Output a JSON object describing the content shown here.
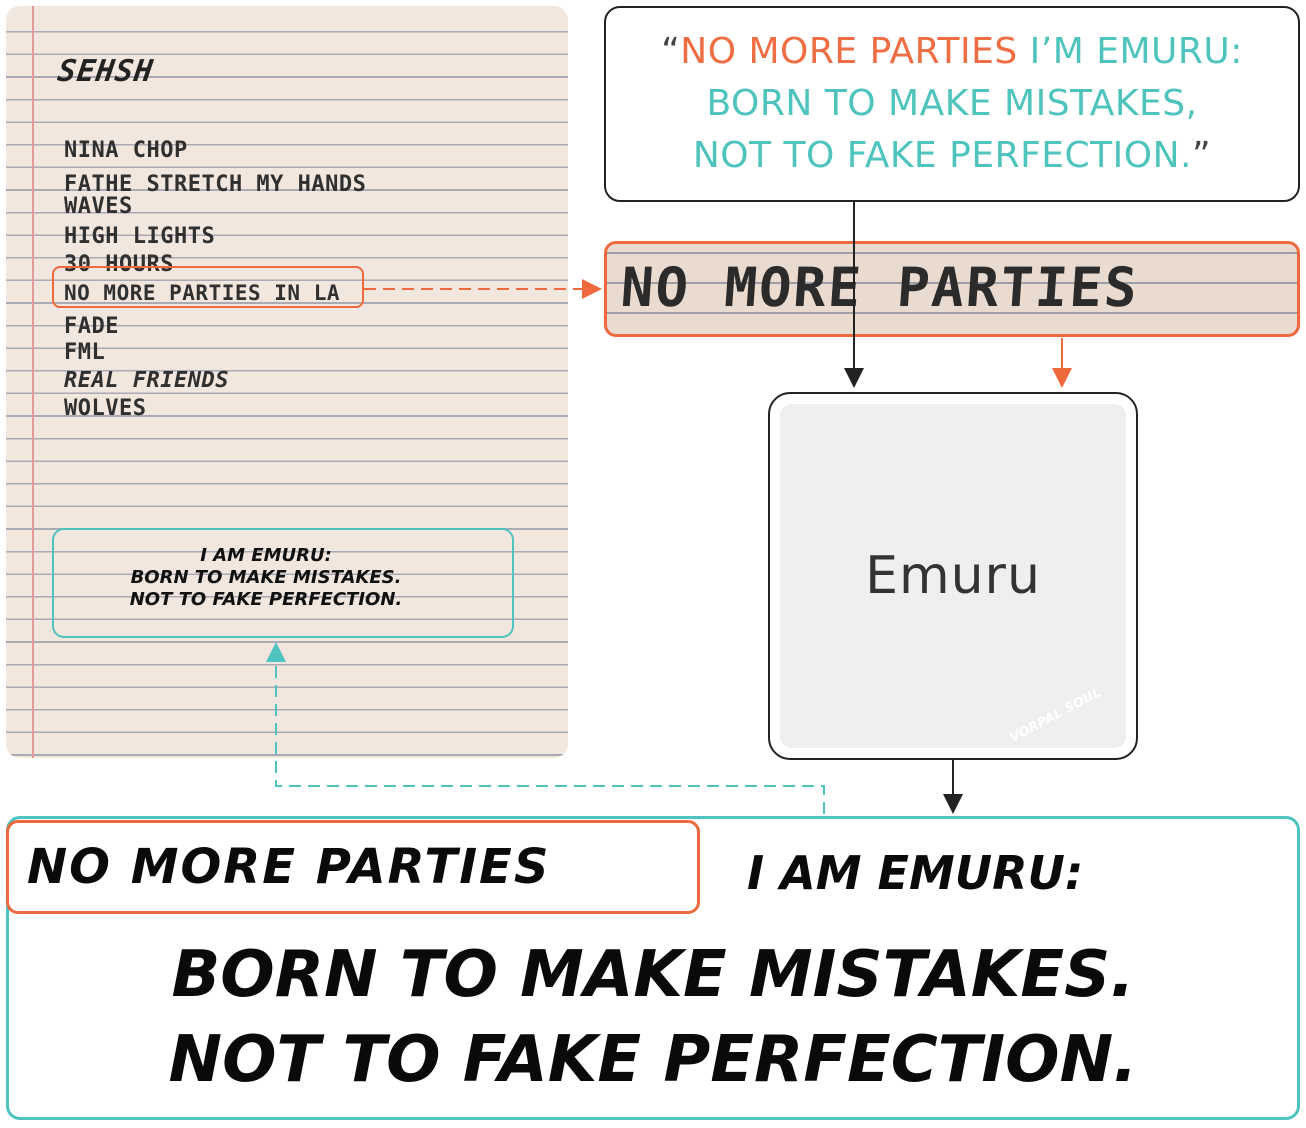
{
  "notebook": {
    "title": "SEHSH",
    "tracks": [
      "NINA CHOP",
      "FATHE STRETCH MY HANDS",
      "WAVES",
      "HIGH LIGHTS",
      "30 HOURS",
      "NO MORE PARTIES IN LA",
      "FADE",
      "FML",
      "REAL FRIENDS",
      "WOLVES"
    ],
    "signature": [
      "I AM EMURU:",
      "BORN TO MAKE MISTAKES.",
      "NOT TO FAKE PERFECTION."
    ]
  },
  "quote": {
    "open_mark": "“",
    "part_orange": "NO MORE PARTIES",
    "part_teal_1": " I’M EMURU:",
    "line2": "BORN TO MAKE MISTAKES,",
    "line3": "NOT TO FAKE PERFECTION.",
    "close_mark": "”"
  },
  "crop_strip": {
    "text": "NO MORE PARTIES"
  },
  "model": {
    "label": "Emuru",
    "watermark": "VORPAL SOUL"
  },
  "output": {
    "style_part": "NO MORE PARTIES",
    "generated_line1": "I AM EMURU:",
    "generated_line2": "BORN TO MAKE MISTAKES.",
    "generated_line3": "NOT TO FAKE PERFECTION."
  },
  "colors": {
    "orange": "#ee6a3e",
    "teal": "#4ec3bf",
    "dark": "#222222"
  }
}
